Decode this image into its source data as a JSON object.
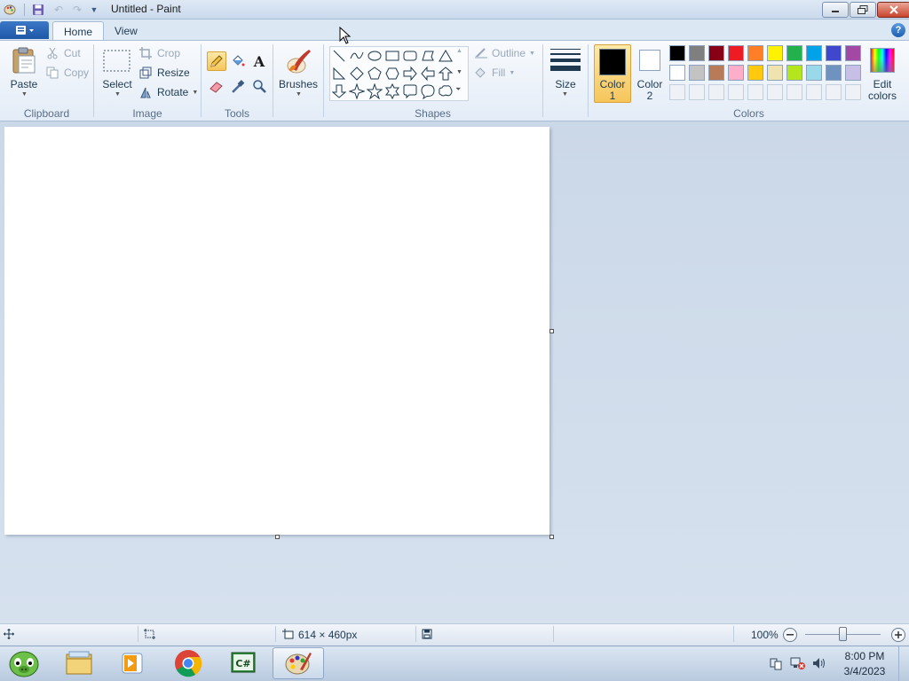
{
  "window": {
    "title": "Untitled - Paint"
  },
  "tabs": {
    "home": "Home",
    "view": "View"
  },
  "clipboard": {
    "paste": "Paste",
    "cut": "Cut",
    "copy": "Copy",
    "group": "Clipboard"
  },
  "image": {
    "select": "Select",
    "crop": "Crop",
    "resize": "Resize",
    "rotate": "Rotate",
    "group": "Image"
  },
  "tools": {
    "group": "Tools"
  },
  "brushes": {
    "label": "Brushes"
  },
  "shapes": {
    "outline": "Outline",
    "fill": "Fill",
    "group": "Shapes"
  },
  "size": {
    "label": "Size"
  },
  "colors": {
    "color1_line1": "Color",
    "color1_line2": "1",
    "color2_line1": "Color",
    "color2_line2": "2",
    "edit_line1": "Edit",
    "edit_line2": "colors",
    "group": "Colors",
    "row1": [
      "#000000",
      "#7f7f7f",
      "#880015",
      "#ed1c24",
      "#ff7f27",
      "#fff200",
      "#22b14c",
      "#00a2e8",
      "#3f48cc",
      "#a349a4"
    ],
    "row2": [
      "#ffffff",
      "#c3c3c3",
      "#b97a57",
      "#ffaec9",
      "#ffc90e",
      "#efe4b0",
      "#b5e61d",
      "#99d9ea",
      "#7092be",
      "#c8bfe7"
    ],
    "selected_color1": "#000000",
    "selected_color2": "#ffffff"
  },
  "status": {
    "canvas_size": "614 × 460px",
    "zoom": "100%",
    "zoom_level": 0.5
  },
  "taskbar": {
    "time": "8:00 PM",
    "date": "3/4/2023"
  }
}
